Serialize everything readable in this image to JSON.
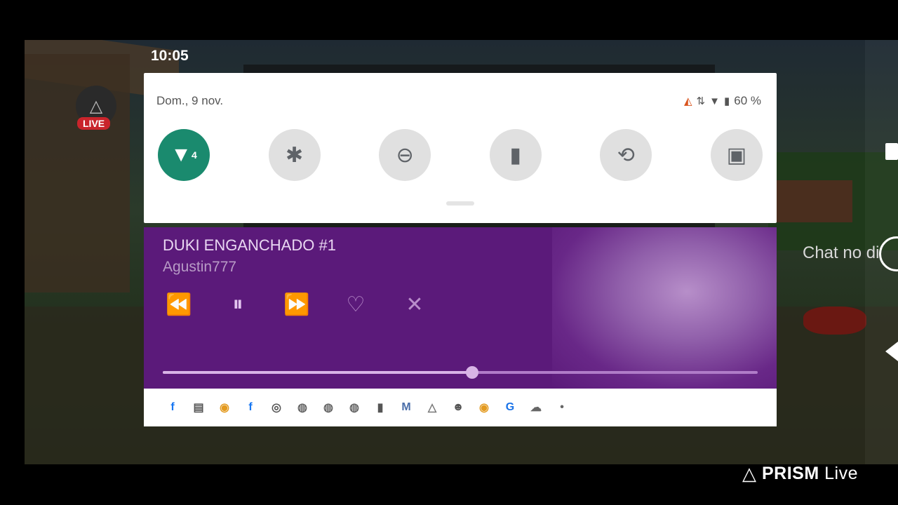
{
  "status": {
    "time": "10:05",
    "date": "Dom., 9 nov.",
    "battery": "60 %"
  },
  "quick_settings": {
    "tiles": [
      {
        "name": "wifi",
        "icon": "wifi-icon",
        "active": true,
        "glyph": "▼",
        "badge": "4"
      },
      {
        "name": "bluetooth",
        "icon": "bluetooth-icon",
        "active": false,
        "glyph": "✱"
      },
      {
        "name": "do-not-disturb",
        "icon": "do-not-disturb-icon",
        "active": false,
        "glyph": "⊖"
      },
      {
        "name": "flashlight",
        "icon": "flashlight-icon",
        "active": false,
        "glyph": "▮"
      },
      {
        "name": "auto-rotate",
        "icon": "rotate-icon",
        "active": false,
        "glyph": "⟲"
      },
      {
        "name": "battery-saver",
        "icon": "battery-saver-icon",
        "active": false,
        "glyph": "▣"
      }
    ]
  },
  "media": {
    "title": "DUKI ENGANCHADO #1",
    "artist": "Agustin777",
    "progress": 0.52
  },
  "notification_icons": [
    {
      "name": "facebook-icon",
      "glyph": "f",
      "color": "#1877f2"
    },
    {
      "name": "news-app-icon",
      "glyph": "▤",
      "color": "#555555"
    },
    {
      "name": "media-app-icon",
      "glyph": "◉",
      "color": "#e39a1f"
    },
    {
      "name": "facebook-icon",
      "glyph": "f",
      "color": "#1877f2"
    },
    {
      "name": "instagram-icon",
      "glyph": "◎",
      "color": "#555555"
    },
    {
      "name": "chrome-icon",
      "glyph": "◍",
      "color": "#666666"
    },
    {
      "name": "chrome-icon",
      "glyph": "◍",
      "color": "#666666"
    },
    {
      "name": "chrome-icon",
      "glyph": "◍",
      "color": "#666666"
    },
    {
      "name": "battery-icon",
      "glyph": "▮",
      "color": "#555555"
    },
    {
      "name": "gmail-icon",
      "glyph": "M",
      "color": "#4a6ea9"
    },
    {
      "name": "prism-icon",
      "glyph": "△",
      "color": "#777777"
    },
    {
      "name": "discord-bot-icon",
      "glyph": "☻",
      "color": "#555555"
    },
    {
      "name": "media-app-icon",
      "glyph": "◉",
      "color": "#e39a1f"
    },
    {
      "name": "translate-icon",
      "glyph": "G",
      "color": "#1a73e8"
    },
    {
      "name": "cloud-icon",
      "glyph": "☁",
      "color": "#666666"
    },
    {
      "name": "more-dot-icon",
      "glyph": "•",
      "color": "#666666"
    }
  ],
  "overlay": {
    "live_label": "LIVE",
    "chat_text": "Chat no di",
    "prism_brand": "PRISM",
    "prism_suffix": "Live"
  }
}
